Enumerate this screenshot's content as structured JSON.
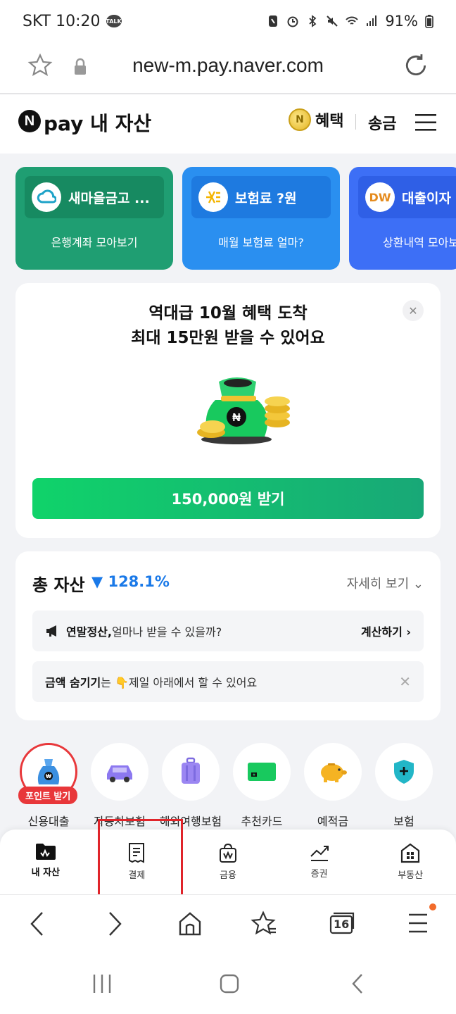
{
  "status_bar": {
    "carrier_time": "SKT 10:20",
    "talk_badge": "TALK",
    "battery": "91%"
  },
  "url_bar": {
    "url": "new-m.pay.naver.com"
  },
  "header": {
    "logo_letter": "N",
    "title": "pay 내 자산",
    "benefit_coin": "N",
    "benefit_label": "혜택",
    "send_label": "송금"
  },
  "cards": [
    {
      "title": "새마을금고 ...",
      "subtitle": "은행계좌 모아보기"
    },
    {
      "title": "보험료 ?원",
      "subtitle": "매월 보험료 얼마?"
    },
    {
      "title": "대출이자",
      "subtitle": "상환내역 모아보",
      "logo": "DW"
    }
  ],
  "promo": {
    "title_line1": "역대급 10월 혜택 도착",
    "title_line2": "최대 15만원 받을 수 있어요",
    "button": "150,000원 받기"
  },
  "assets": {
    "title": "총 자산",
    "change": "▼ 128.1%",
    "more": "자세히 보기",
    "notice1_bold": "연말정산,",
    "notice1_text": " 얼마나 받을 수 있을까?",
    "notice1_action": "계산하기",
    "notice2_bold": "금액 숨기기",
    "notice2_text": "는 👇제일 아래에서 할 수 있어요"
  },
  "shortcuts": [
    {
      "label": "신용대출",
      "badge": "포인트 받기"
    },
    {
      "label": "자동차보험"
    },
    {
      "label": "해외여행보험"
    },
    {
      "label": "추천카드"
    },
    {
      "label": "예적금"
    },
    {
      "label": "보험"
    }
  ],
  "tabs": [
    "내 자산",
    "결제",
    "금융",
    "증권",
    "부동산"
  ],
  "browser_nav": {
    "tab_count": "16"
  },
  "colors": {
    "green_card": "#1f9e72",
    "blue_card": "#2a8ff0",
    "indigo_card": "#3d6ff6",
    "promo_button": "#10d36a",
    "highlight": "#e0242a",
    "accent_blue": "#1a79e8"
  }
}
